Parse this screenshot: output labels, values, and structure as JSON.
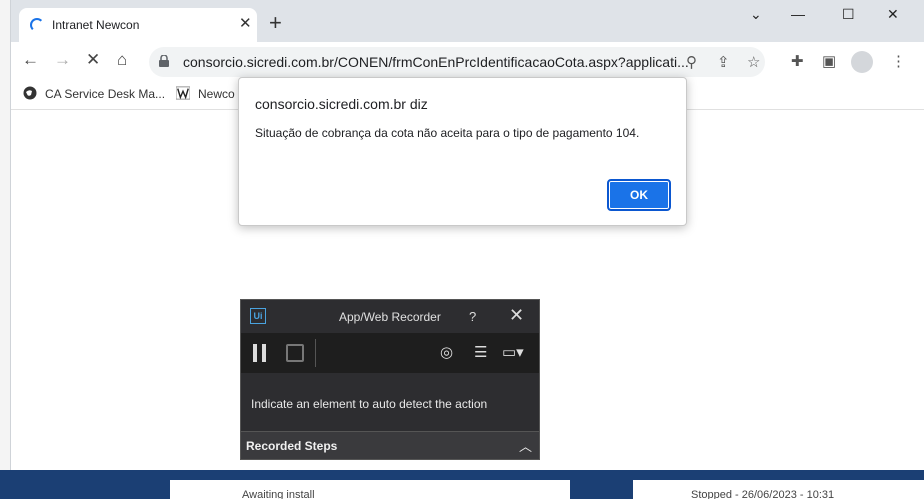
{
  "colors": {
    "accent": "#1a73e8",
    "desktop": "#1b3f74",
    "recorder_bg": "#2d2d30"
  },
  "browser": {
    "tab_title": "Intranet Newcon",
    "url": "consorcio.sicredi.com.br/CONEN/frmConEnPrcIdentificacaoCota.aspx?applicati...",
    "bookmarks": [
      {
        "label": "CA Service Desk Ma...",
        "icon": "globe-icon"
      },
      {
        "label": "Newco",
        "icon": "newcon-logo-icon"
      }
    ]
  },
  "alert": {
    "host": "consorcio.sicredi.com.br diz",
    "message": "Situação de cobrança da cota não aceita para o tipo de pagamento 104.",
    "ok_label": "OK"
  },
  "recorder": {
    "logo": "Ui",
    "title": "App/Web Recorder",
    "help": "?",
    "hint": "Indicate an element to auto detect the action",
    "steps_label": "Recorded Steps"
  },
  "background_tasks": [
    {
      "text": "Awaiting install"
    },
    {
      "text": "Stopped - 26/06/2023 - 10:31"
    }
  ]
}
